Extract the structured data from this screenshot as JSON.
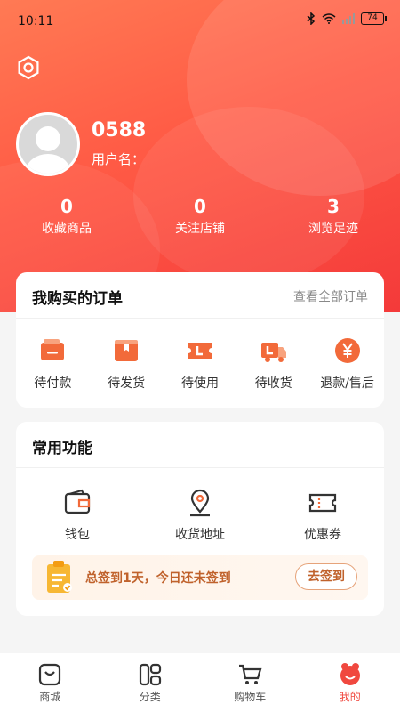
{
  "status_bar": {
    "time": "10:11",
    "battery": "74"
  },
  "profile": {
    "username": "0588",
    "user_label": "用户名："
  },
  "stats": [
    {
      "value": "0",
      "label": "收藏商品"
    },
    {
      "value": "0",
      "label": "关注店铺"
    },
    {
      "value": "3",
      "label": "浏览足迹"
    }
  ],
  "orders": {
    "title": "我购买的订单",
    "view_all": "查看全部订单",
    "items": [
      {
        "label": "待付款",
        "icon": "wallet-card-icon"
      },
      {
        "label": "待发货",
        "icon": "box-icon"
      },
      {
        "label": "待使用",
        "icon": "ticket-icon"
      },
      {
        "label": "待收货",
        "icon": "truck-icon"
      },
      {
        "label": "退款/售后",
        "icon": "yuan-icon"
      }
    ]
  },
  "functions": {
    "title": "常用功能",
    "items": [
      {
        "label": "钱包",
        "icon": "wallet-icon"
      },
      {
        "label": "收货地址",
        "icon": "location-icon"
      },
      {
        "label": "优惠券",
        "icon": "coupon-icon"
      }
    ],
    "signin": {
      "text": "总签到1天，今日还未签到",
      "button": "去签到"
    }
  },
  "tabbar": [
    {
      "label": "商城",
      "icon": "shop-icon"
    },
    {
      "label": "分类",
      "icon": "category-icon"
    },
    {
      "label": "购物车",
      "icon": "cart-icon"
    },
    {
      "label": "我的",
      "icon": "profile-icon",
      "active": true
    }
  ],
  "colors": {
    "accent": "#f0483f",
    "orange": "#f26a3a"
  }
}
